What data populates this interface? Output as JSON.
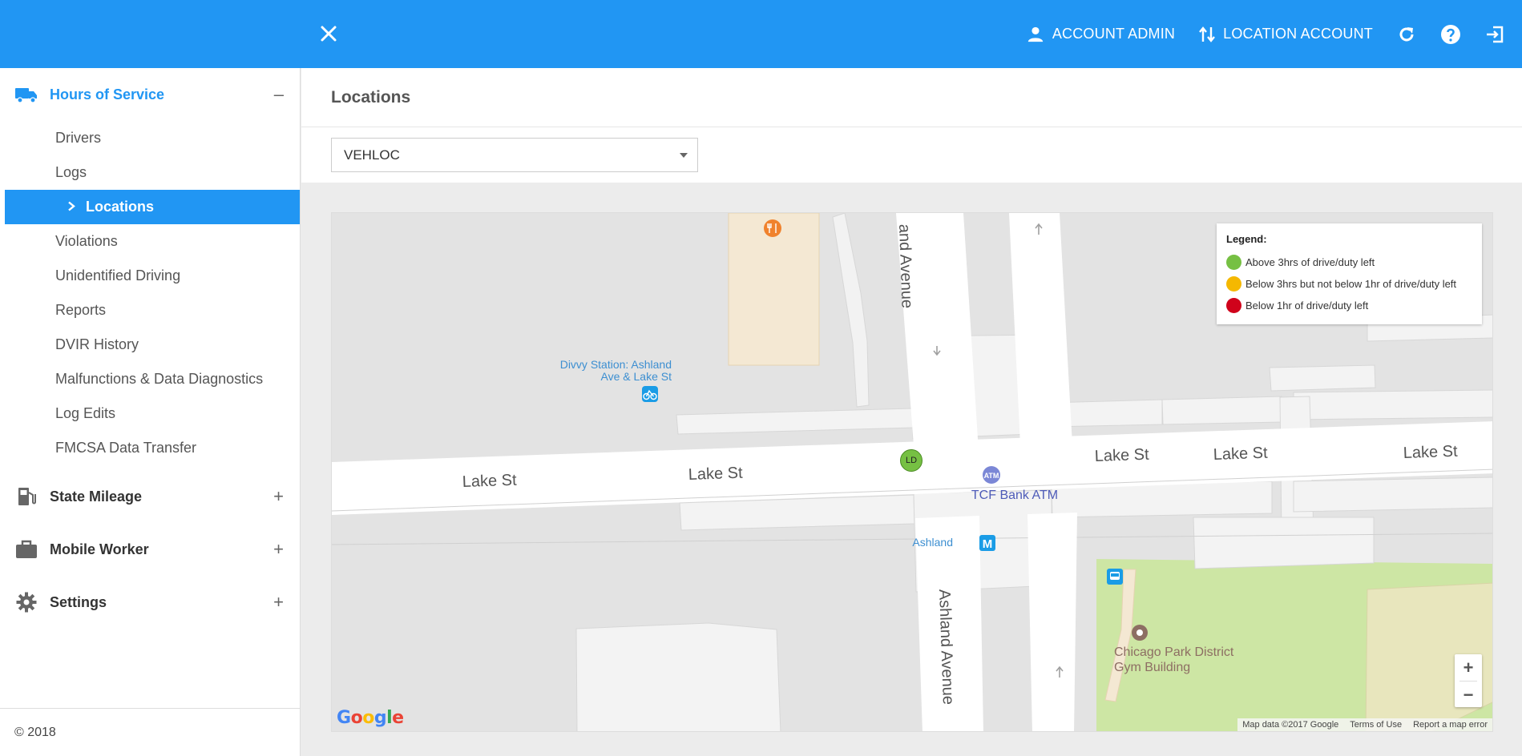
{
  "topbar": {
    "account_admin_label": "ACCOUNT ADMIN",
    "location_account_label": "LOCATION ACCOUNT"
  },
  "sidebar": {
    "sections": [
      {
        "label": "Hours of Service",
        "icon": "truck-icon",
        "toggle": "–"
      },
      {
        "label": "State Mileage",
        "icon": "fuel-pump-icon",
        "toggle": "+"
      },
      {
        "label": "Mobile Worker",
        "icon": "briefcase-icon",
        "toggle": "+"
      },
      {
        "label": "Settings",
        "icon": "gear-icon",
        "toggle": "+"
      }
    ],
    "items": [
      {
        "label": "Drivers"
      },
      {
        "label": "Logs"
      },
      {
        "label": "Locations"
      },
      {
        "label": "Violations"
      },
      {
        "label": "Unidentified Driving"
      },
      {
        "label": "Reports"
      },
      {
        "label": "DVIR History"
      },
      {
        "label": "Malfunctions & Data Diagnostics"
      },
      {
        "label": "Log Edits"
      },
      {
        "label": "FMCSA Data Transfer"
      }
    ],
    "footer": "© 2018"
  },
  "main": {
    "title": "Locations",
    "select_value": "VEHLOC"
  },
  "map": {
    "legend": {
      "title": "Legend:",
      "rows": [
        {
          "label": "Above 3hrs of drive/duty left",
          "color": "#76c043"
        },
        {
          "label": "Below 3hrs but not below 1hr of drive/duty left",
          "color": "#f5b800"
        },
        {
          "label": "Below 1hr of drive/duty left",
          "color": "#d0021b"
        }
      ]
    },
    "labels": {
      "street_1": "Lake St",
      "street_2": "Lake St",
      "street_3": "Lake St",
      "street_4": "Lake St",
      "street_5": "Lake St",
      "avenue_top": "and Avenue",
      "avenue_bottom": "Ashland Avenue",
      "divvy_line1": "Divvy Station: Ashland",
      "divvy_line2": "Ave & Lake St",
      "atm": "TCF Bank ATM",
      "atm_badge": "ATM",
      "station": "Ashland",
      "station_badge": "M",
      "park_line1": "Chicago Park District",
      "park_line2": "Gym Building",
      "marker": "LD"
    },
    "zoom_in": "+",
    "zoom_out": "−",
    "attribution": {
      "data": "Map data ©2017 Google",
      "terms": "Terms of Use",
      "report": "Report a map error"
    },
    "google_logo": "Google",
    "colors": {
      "park": "#cde6a4",
      "building": "#f5f5f5",
      "road": "#ffffff",
      "block": "#e3e3e3",
      "poi_food": "#f0822d",
      "transit": "#1a9ce6"
    }
  }
}
